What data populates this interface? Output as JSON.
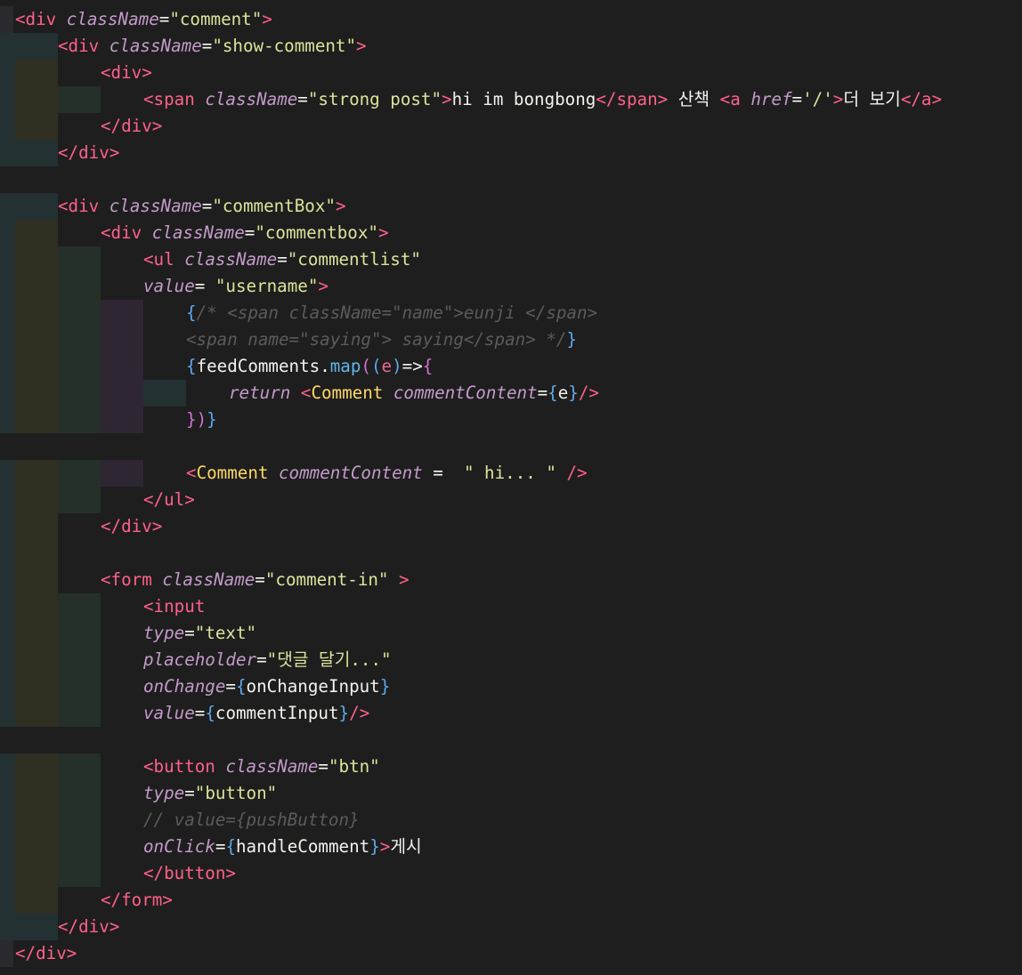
{
  "editor": {
    "language": "jsx",
    "theme": "dark",
    "lines": [
      {
        "indent": 0,
        "tokens": [
          [
            "tg",
            "<div"
          ],
          [
            "p",
            " "
          ],
          [
            "at",
            "className"
          ],
          [
            "p",
            "="
          ],
          [
            "st",
            "\"comment\""
          ],
          [
            "tg",
            ">"
          ]
        ]
      },
      {
        "indent": 1,
        "tokens": [
          [
            "tg",
            "<div"
          ],
          [
            "p",
            " "
          ],
          [
            "at",
            "className"
          ],
          [
            "p",
            "="
          ],
          [
            "st",
            "\"show-comment\""
          ],
          [
            "tg",
            ">"
          ]
        ]
      },
      {
        "indent": 2,
        "tokens": [
          [
            "tg",
            "<div>"
          ]
        ]
      },
      {
        "indent": 3,
        "tokens": [
          [
            "tg",
            "<span"
          ],
          [
            "p",
            " "
          ],
          [
            "at",
            "className"
          ],
          [
            "p",
            "="
          ],
          [
            "st",
            "\"strong post\""
          ],
          [
            "tg",
            ">"
          ],
          [
            "tx",
            "hi im bongbong"
          ],
          [
            "tg",
            "</span>"
          ],
          [
            "tx",
            " 산책 "
          ],
          [
            "tg",
            "<a"
          ],
          [
            "p",
            " "
          ],
          [
            "at",
            "href"
          ],
          [
            "p",
            "="
          ],
          [
            "st",
            "'/'"
          ],
          [
            "tg",
            ">"
          ],
          [
            "tx",
            "더 보기"
          ],
          [
            "tg",
            "</a>"
          ]
        ]
      },
      {
        "indent": 2,
        "tokens": [
          [
            "tg",
            "</div>"
          ]
        ]
      },
      {
        "indent": 1,
        "tokens": [
          [
            "tg",
            "</div>"
          ]
        ]
      },
      {
        "indent": 0,
        "tokens": []
      },
      {
        "indent": 1,
        "tokens": [
          [
            "tg",
            "<div"
          ],
          [
            "p",
            " "
          ],
          [
            "at",
            "className"
          ],
          [
            "p",
            "="
          ],
          [
            "st",
            "\"commentBox\""
          ],
          [
            "tg",
            ">"
          ]
        ]
      },
      {
        "indent": 2,
        "tokens": [
          [
            "tg",
            "<div"
          ],
          [
            "p",
            " "
          ],
          [
            "at",
            "className"
          ],
          [
            "p",
            "="
          ],
          [
            "st",
            "\"commentbox\""
          ],
          [
            "tg",
            ">"
          ]
        ]
      },
      {
        "indent": 3,
        "tokens": [
          [
            "tg",
            "<ul"
          ],
          [
            "p",
            " "
          ],
          [
            "at",
            "className"
          ],
          [
            "p",
            "="
          ],
          [
            "st",
            "\"commentlist\""
          ]
        ]
      },
      {
        "indent": 3,
        "tokens": [
          [
            "at",
            "value"
          ],
          [
            "p",
            "= "
          ],
          [
            "st",
            "\"username\""
          ],
          [
            "tg",
            ">"
          ]
        ]
      },
      {
        "indent": 4,
        "tokens": [
          [
            "br",
            "{"
          ],
          [
            "cm",
            "/* <span className=\"name\">eunji </span>"
          ]
        ]
      },
      {
        "indent": 4,
        "tokens": [
          [
            "cm",
            "<span name=\"saying\"> saying</span> */"
          ],
          [
            "br",
            "}"
          ]
        ]
      },
      {
        "indent": 4,
        "tokens": [
          [
            "br",
            "{"
          ],
          [
            "tx",
            "feedComments"
          ],
          [
            "p",
            "."
          ],
          [
            "fn",
            "map"
          ],
          [
            "br2",
            "("
          ],
          [
            "br",
            "("
          ],
          [
            "pa",
            "e"
          ],
          [
            "br",
            ")"
          ],
          [
            "op",
            "=>"
          ],
          [
            "br2",
            "{"
          ]
        ]
      },
      {
        "indent": 5,
        "tokens": [
          [
            "kw",
            "return"
          ],
          [
            "p",
            " "
          ],
          [
            "tg",
            "<"
          ],
          [
            "cp",
            "Comment"
          ],
          [
            "p",
            " "
          ],
          [
            "at",
            "commentContent"
          ],
          [
            "p",
            "="
          ],
          [
            "br",
            "{"
          ],
          [
            "tx",
            "e"
          ],
          [
            "br",
            "}"
          ],
          [
            "tg",
            "/>"
          ]
        ]
      },
      {
        "indent": 4,
        "tokens": [
          [
            "br2",
            "}"
          ],
          [
            "br2",
            ")"
          ],
          [
            "br",
            "}"
          ]
        ]
      },
      {
        "indent": 0,
        "tokens": []
      },
      {
        "indent": 4,
        "tokens": [
          [
            "tg",
            "<"
          ],
          [
            "cp",
            "Comment"
          ],
          [
            "p",
            " "
          ],
          [
            "at",
            "commentContent"
          ],
          [
            "p",
            " = "
          ],
          [
            "st",
            " \" hi... \""
          ],
          [
            "p",
            " "
          ],
          [
            "tg",
            "/>"
          ]
        ]
      },
      {
        "indent": 3,
        "tokens": [
          [
            "tg",
            "</ul>"
          ]
        ]
      },
      {
        "indent": 2,
        "tokens": [
          [
            "tg",
            "</div>"
          ]
        ]
      },
      {
        "indent": 2,
        "tokens": []
      },
      {
        "indent": 2,
        "tokens": [
          [
            "tg",
            "<form"
          ],
          [
            "p",
            " "
          ],
          [
            "at",
            "className"
          ],
          [
            "p",
            "="
          ],
          [
            "st",
            "\"comment-in\""
          ],
          [
            "p",
            " "
          ],
          [
            "tg",
            ">"
          ]
        ]
      },
      {
        "indent": 3,
        "tokens": [
          [
            "tg",
            "<input"
          ]
        ]
      },
      {
        "indent": 3,
        "tokens": [
          [
            "at",
            "type"
          ],
          [
            "p",
            "="
          ],
          [
            "st",
            "\"text\""
          ]
        ]
      },
      {
        "indent": 3,
        "tokens": [
          [
            "at",
            "placeholder"
          ],
          [
            "p",
            "="
          ],
          [
            "st",
            "\"댓글 달기...\""
          ]
        ]
      },
      {
        "indent": 3,
        "tokens": [
          [
            "at",
            "onChange"
          ],
          [
            "p",
            "="
          ],
          [
            "br",
            "{"
          ],
          [
            "tx",
            "onChangeInput"
          ],
          [
            "br",
            "}"
          ]
        ]
      },
      {
        "indent": 3,
        "tokens": [
          [
            "at",
            "value"
          ],
          [
            "p",
            "="
          ],
          [
            "br",
            "{"
          ],
          [
            "tx",
            "commentInput"
          ],
          [
            "br",
            "}"
          ],
          [
            "tg",
            "/>"
          ]
        ]
      },
      {
        "indent": 0,
        "tokens": []
      },
      {
        "indent": 3,
        "tokens": [
          [
            "tg",
            "<button"
          ],
          [
            "p",
            " "
          ],
          [
            "at",
            "className"
          ],
          [
            "p",
            "="
          ],
          [
            "st",
            "\"btn\""
          ]
        ]
      },
      {
        "indent": 3,
        "tokens": [
          [
            "at",
            "type"
          ],
          [
            "p",
            "="
          ],
          [
            "st",
            "\"button\""
          ]
        ]
      },
      {
        "indent": 3,
        "tokens": [
          [
            "cm",
            "// value={pushButton}"
          ]
        ]
      },
      {
        "indent": 3,
        "tokens": [
          [
            "at",
            "onClick"
          ],
          [
            "p",
            "="
          ],
          [
            "br",
            "{"
          ],
          [
            "tx",
            "handleComment"
          ],
          [
            "br",
            "}"
          ],
          [
            "tg",
            ">"
          ],
          [
            "tx",
            "게시"
          ]
        ]
      },
      {
        "indent": 3,
        "tokens": [
          [
            "tg",
            "</button>"
          ]
        ]
      },
      {
        "indent": 2,
        "tokens": [
          [
            "tg",
            "</form>"
          ]
        ]
      },
      {
        "indent": 1,
        "tokens": [
          [
            "tg",
            "</div>"
          ]
        ]
      },
      {
        "indent": 0,
        "tokens": [
          [
            "tg",
            "</div>"
          ]
        ]
      }
    ],
    "indent_colors": [
      "#2a2a2e",
      "#243133",
      "#302f22",
      "#253029",
      "#2f2633",
      "#243133"
    ]
  }
}
